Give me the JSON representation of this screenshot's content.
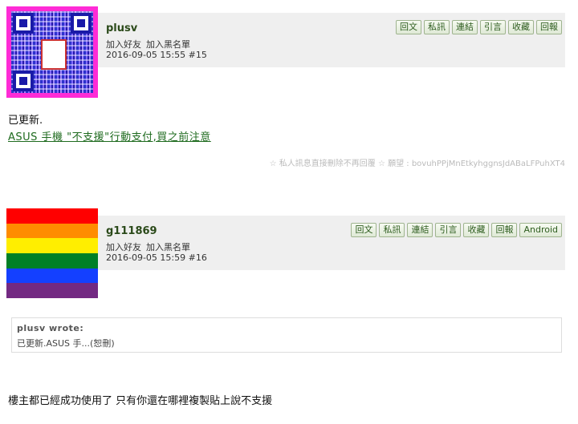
{
  "post1": {
    "username": "plusv",
    "add_friend": "加入好友",
    "add_blacklist": "加入黑名單",
    "meta": "2016-09-05 15:55  #15",
    "buttons": [
      "回文",
      "私訊",
      "連結",
      "引言",
      "收藏",
      "回報"
    ],
    "content_line": "已更新.",
    "content_link": "ASUS 手機 \"不支援\"行動支付,買之前注意",
    "signature": "☆ 私人訊息直接刪除不再回覆 ☆ 願望 : bovuhPPjMnEtkyhggnsJdABaLFPuhXT4",
    "avatar_colors": [
      "#ff2bd6",
      "#1a1aa8"
    ]
  },
  "post2": {
    "username": "g111869",
    "add_friend": "加入好友",
    "add_blacklist": "加入黑名單",
    "meta": "2016-09-05 15:59  #16",
    "buttons": [
      "回文",
      "私訊",
      "連結",
      "引言",
      "收藏",
      "回報",
      "Android"
    ],
    "quote_author": "plusv wrote:",
    "quote_body": "已更新.ASUS 手...(恕刪)",
    "content": "樓主都已經成功使用了 只有你還在哪裡複製貼上說不支援",
    "avatar_colors": [
      "#ff0000",
      "#ff8c00",
      "#ffee00",
      "#008026",
      "#1440ff",
      "#732982"
    ]
  }
}
